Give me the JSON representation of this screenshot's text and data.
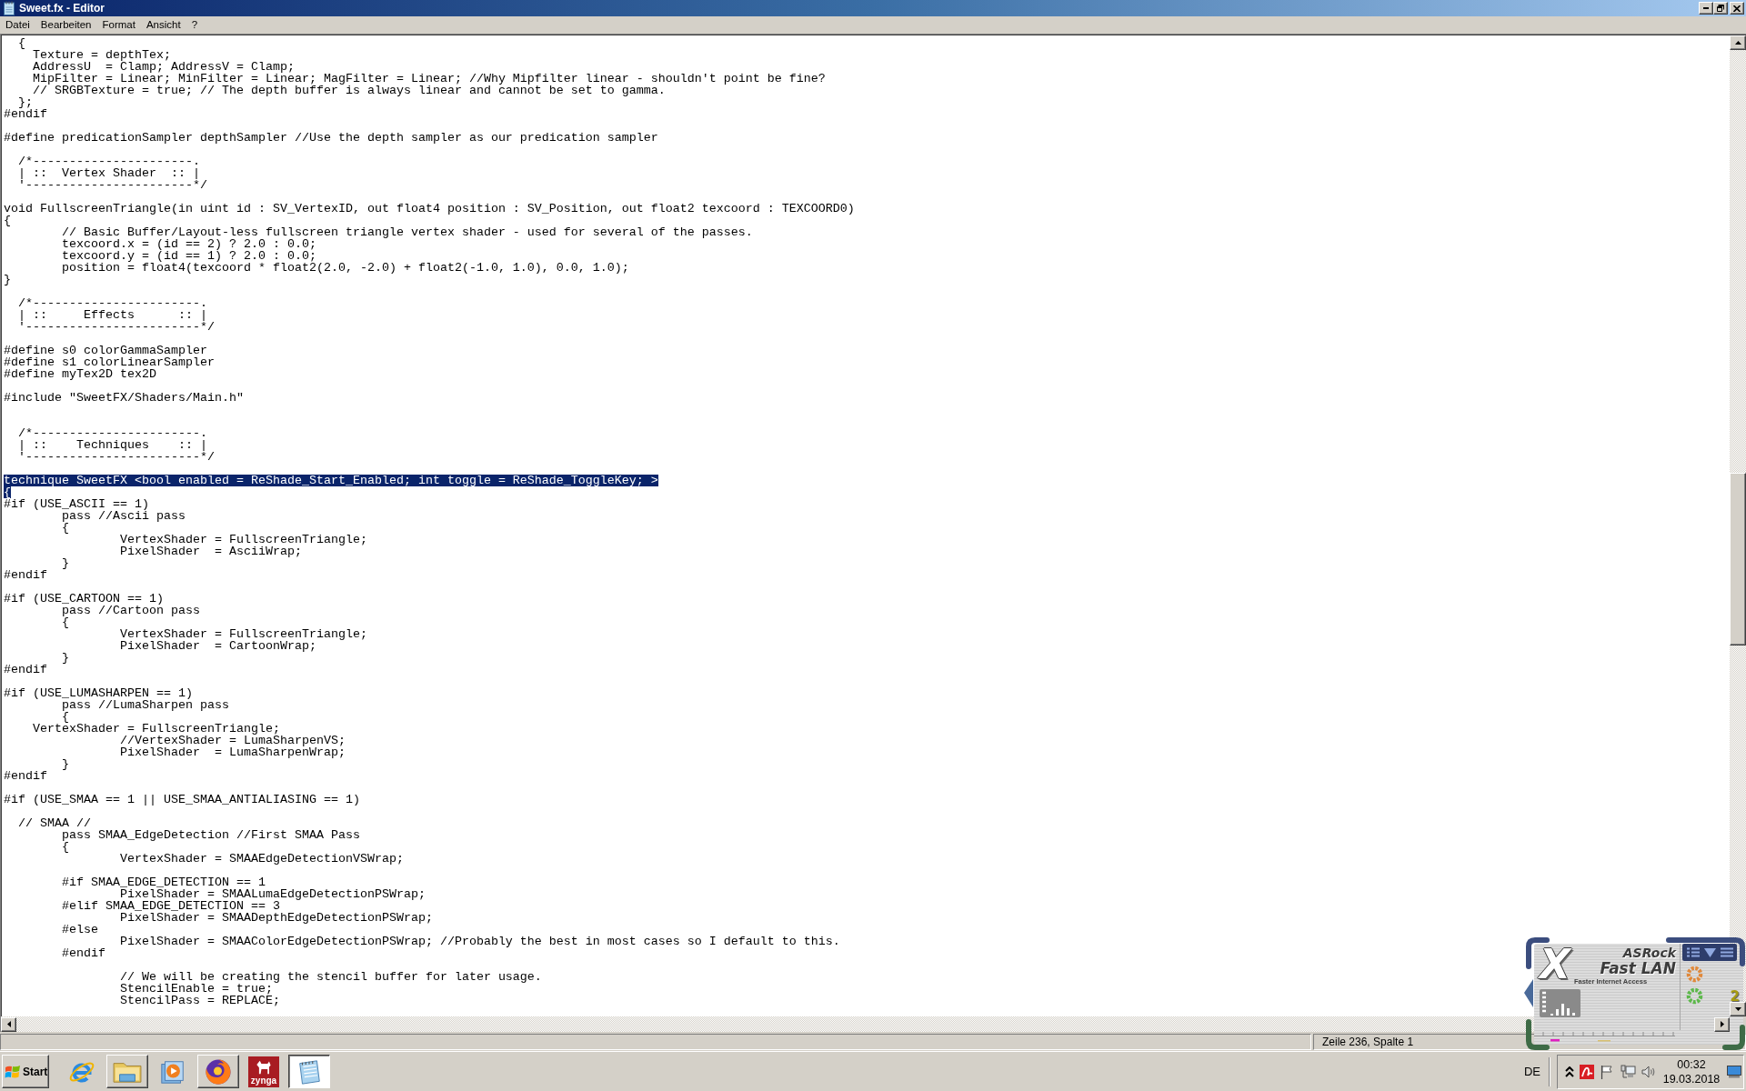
{
  "window": {
    "title": "Sweet.fx - Editor"
  },
  "menu": [
    "Datei",
    "Bearbeiten",
    "Format",
    "Ansicht",
    "?"
  ],
  "editor": {
    "lines": [
      {
        "text": "  {",
        "selected": false
      },
      {
        "text": "    Texture = depthTex;",
        "selected": false
      },
      {
        "text": "    AddressU  = Clamp; AddressV = Clamp;",
        "selected": false
      },
      {
        "text": "    MipFilter = Linear; MinFilter = Linear; MagFilter = Linear; //Why Mipfilter linear - shouldn't point be fine?",
        "selected": false
      },
      {
        "text": "    // SRGBTexture = true; // The depth buffer is always linear and cannot be set to gamma.",
        "selected": false
      },
      {
        "text": "  };",
        "selected": false
      },
      {
        "text": "#endif",
        "selected": false
      },
      {
        "selected": false
      },
      {
        "text": "#define predicationSampler depthSampler //Use the depth sampler as our predication sampler",
        "selected": false
      },
      {
        "selected": false
      },
      {
        "text": "  /*----------------------.",
        "selected": false
      },
      {
        "text": "  | ::  Vertex Shader  :: |",
        "selected": false
      },
      {
        "text": "  '-----------------------*/",
        "selected": false
      },
      {
        "selected": false
      },
      {
        "text": "void FullscreenTriangle(in uint id : SV_VertexID, out float4 position : SV_Position, out float2 texcoord : TEXCOORD0)",
        "selected": false
      },
      {
        "text": "{",
        "selected": false
      },
      {
        "text": "        // Basic Buffer/Layout-less fullscreen triangle vertex shader - used for several of the passes.",
        "selected": false
      },
      {
        "text": "        texcoord.x = (id == 2) ? 2.0 : 0.0;",
        "selected": false
      },
      {
        "text": "        texcoord.y = (id == 1) ? 2.0 : 0.0;",
        "selected": false
      },
      {
        "text": "        position = float4(texcoord * float2(2.0, -2.0) + float2(-1.0, 1.0), 0.0, 1.0);",
        "selected": false
      },
      {
        "text": "}",
        "selected": false
      },
      {
        "selected": false
      },
      {
        "text": "  /*-----------------------.",
        "selected": false
      },
      {
        "text": "  | ::     Effects      :: |",
        "selected": false
      },
      {
        "text": "  '------------------------*/",
        "selected": false
      },
      {
        "selected": false
      },
      {
        "text": "#define s0 colorGammaSampler",
        "selected": false
      },
      {
        "text": "#define s1 colorLinearSampler",
        "selected": false
      },
      {
        "text": "#define myTex2D tex2D",
        "selected": false
      },
      {
        "selected": false
      },
      {
        "text": "#include \"SweetFX/Shaders/Main.h\"",
        "selected": false
      },
      {
        "selected": false
      },
      {
        "selected": false
      },
      {
        "text": "  /*-----------------------.",
        "selected": false
      },
      {
        "text": "  | ::    Techniques    :: |",
        "selected": false
      },
      {
        "text": "  '------------------------*/",
        "selected": false
      },
      {
        "selected": false
      },
      {
        "text": "technique SweetFX <bool enabled = ReShade_Start_Enabled; int toggle = ReShade_ToggleKey; >",
        "selected": true
      },
      {
        "text": "{",
        "selected": true
      },
      {
        "text": "#if (USE_ASCII == 1)",
        "selected": false
      },
      {
        "text": "        pass //Ascii pass",
        "selected": false
      },
      {
        "text": "        {",
        "selected": false
      },
      {
        "text": "                VertexShader = FullscreenTriangle;",
        "selected": false
      },
      {
        "text": "                PixelShader  = AsciiWrap;",
        "selected": false
      },
      {
        "text": "        }",
        "selected": false
      },
      {
        "text": "#endif",
        "selected": false
      },
      {
        "selected": false
      },
      {
        "text": "#if (USE_CARTOON == 1)",
        "selected": false
      },
      {
        "text": "        pass //Cartoon pass",
        "selected": false
      },
      {
        "text": "        {",
        "selected": false
      },
      {
        "text": "                VertexShader = FullscreenTriangle;",
        "selected": false
      },
      {
        "text": "                PixelShader  = CartoonWrap;",
        "selected": false
      },
      {
        "text": "        }",
        "selected": false
      },
      {
        "text": "#endif",
        "selected": false
      },
      {
        "selected": false
      },
      {
        "text": "#if (USE_LUMASHARPEN == 1)",
        "selected": false
      },
      {
        "text": "        pass //LumaSharpen pass",
        "selected": false
      },
      {
        "text": "        {",
        "selected": false
      },
      {
        "text": "    VertexShader = FullscreenTriangle;",
        "selected": false
      },
      {
        "text": "                //VertexShader = LumaSharpenVS;",
        "selected": false
      },
      {
        "text": "                PixelShader  = LumaSharpenWrap;",
        "selected": false
      },
      {
        "text": "        }",
        "selected": false
      },
      {
        "text": "#endif",
        "selected": false
      },
      {
        "selected": false
      },
      {
        "text": "#if (USE_SMAA == 1 || USE_SMAA_ANTIALIASING == 1)",
        "selected": false
      },
      {
        "selected": false
      },
      {
        "text": "  // SMAA //",
        "selected": false
      },
      {
        "text": "        pass SMAA_EdgeDetection //First SMAA Pass",
        "selected": false
      },
      {
        "text": "        {",
        "selected": false
      },
      {
        "text": "                VertexShader = SMAAEdgeDetectionVSWrap;",
        "selected": false
      },
      {
        "selected": false
      },
      {
        "text": "        #if SMAA_EDGE_DETECTION == 1",
        "selected": false
      },
      {
        "text": "                PixelShader = SMAALumaEdgeDetectionPSWrap;",
        "selected": false
      },
      {
        "text": "        #elif SMAA_EDGE_DETECTION == 3",
        "selected": false
      },
      {
        "text": "                PixelShader = SMAADepthEdgeDetectionPSWrap;",
        "selected": false
      },
      {
        "text": "        #else",
        "selected": false
      },
      {
        "text": "                PixelShader = SMAAColorEdgeDetectionPSWrap; //Probably the best in most cases so I default to this.",
        "selected": false
      },
      {
        "text": "        #endif",
        "selected": false
      },
      {
        "selected": false
      },
      {
        "text": "                // We will be creating the stencil buffer for later usage.",
        "selected": false
      },
      {
        "text": "                StencilEnable = true;",
        "selected": false
      },
      {
        "text": "                StencilPass = REPLACE;",
        "selected": false
      }
    ]
  },
  "status_bar": {
    "position": "Zeile 236, Spalte 1"
  },
  "network_widget": {
    "brand": "ASRock",
    "logo_letter": "X",
    "product": "Fast LAN",
    "tagline": "Faster Internet Access",
    "count": "2"
  },
  "taskbar": {
    "start_label": "Start",
    "apps": [
      {
        "kind": "ebrowser",
        "open": false,
        "selected": false
      },
      {
        "kind": "folder",
        "open": true,
        "selected": false
      },
      {
        "kind": "player",
        "open": false,
        "selected": false
      },
      {
        "kind": "foxbrowser",
        "open": true,
        "selected": false
      },
      {
        "kind": "dog",
        "label": "zynga",
        "open": false,
        "selected": false
      },
      {
        "kind": "notepad",
        "open": true,
        "selected": true
      }
    ],
    "language": "DE",
    "time": "00:32",
    "date": "19.03.2018"
  }
}
